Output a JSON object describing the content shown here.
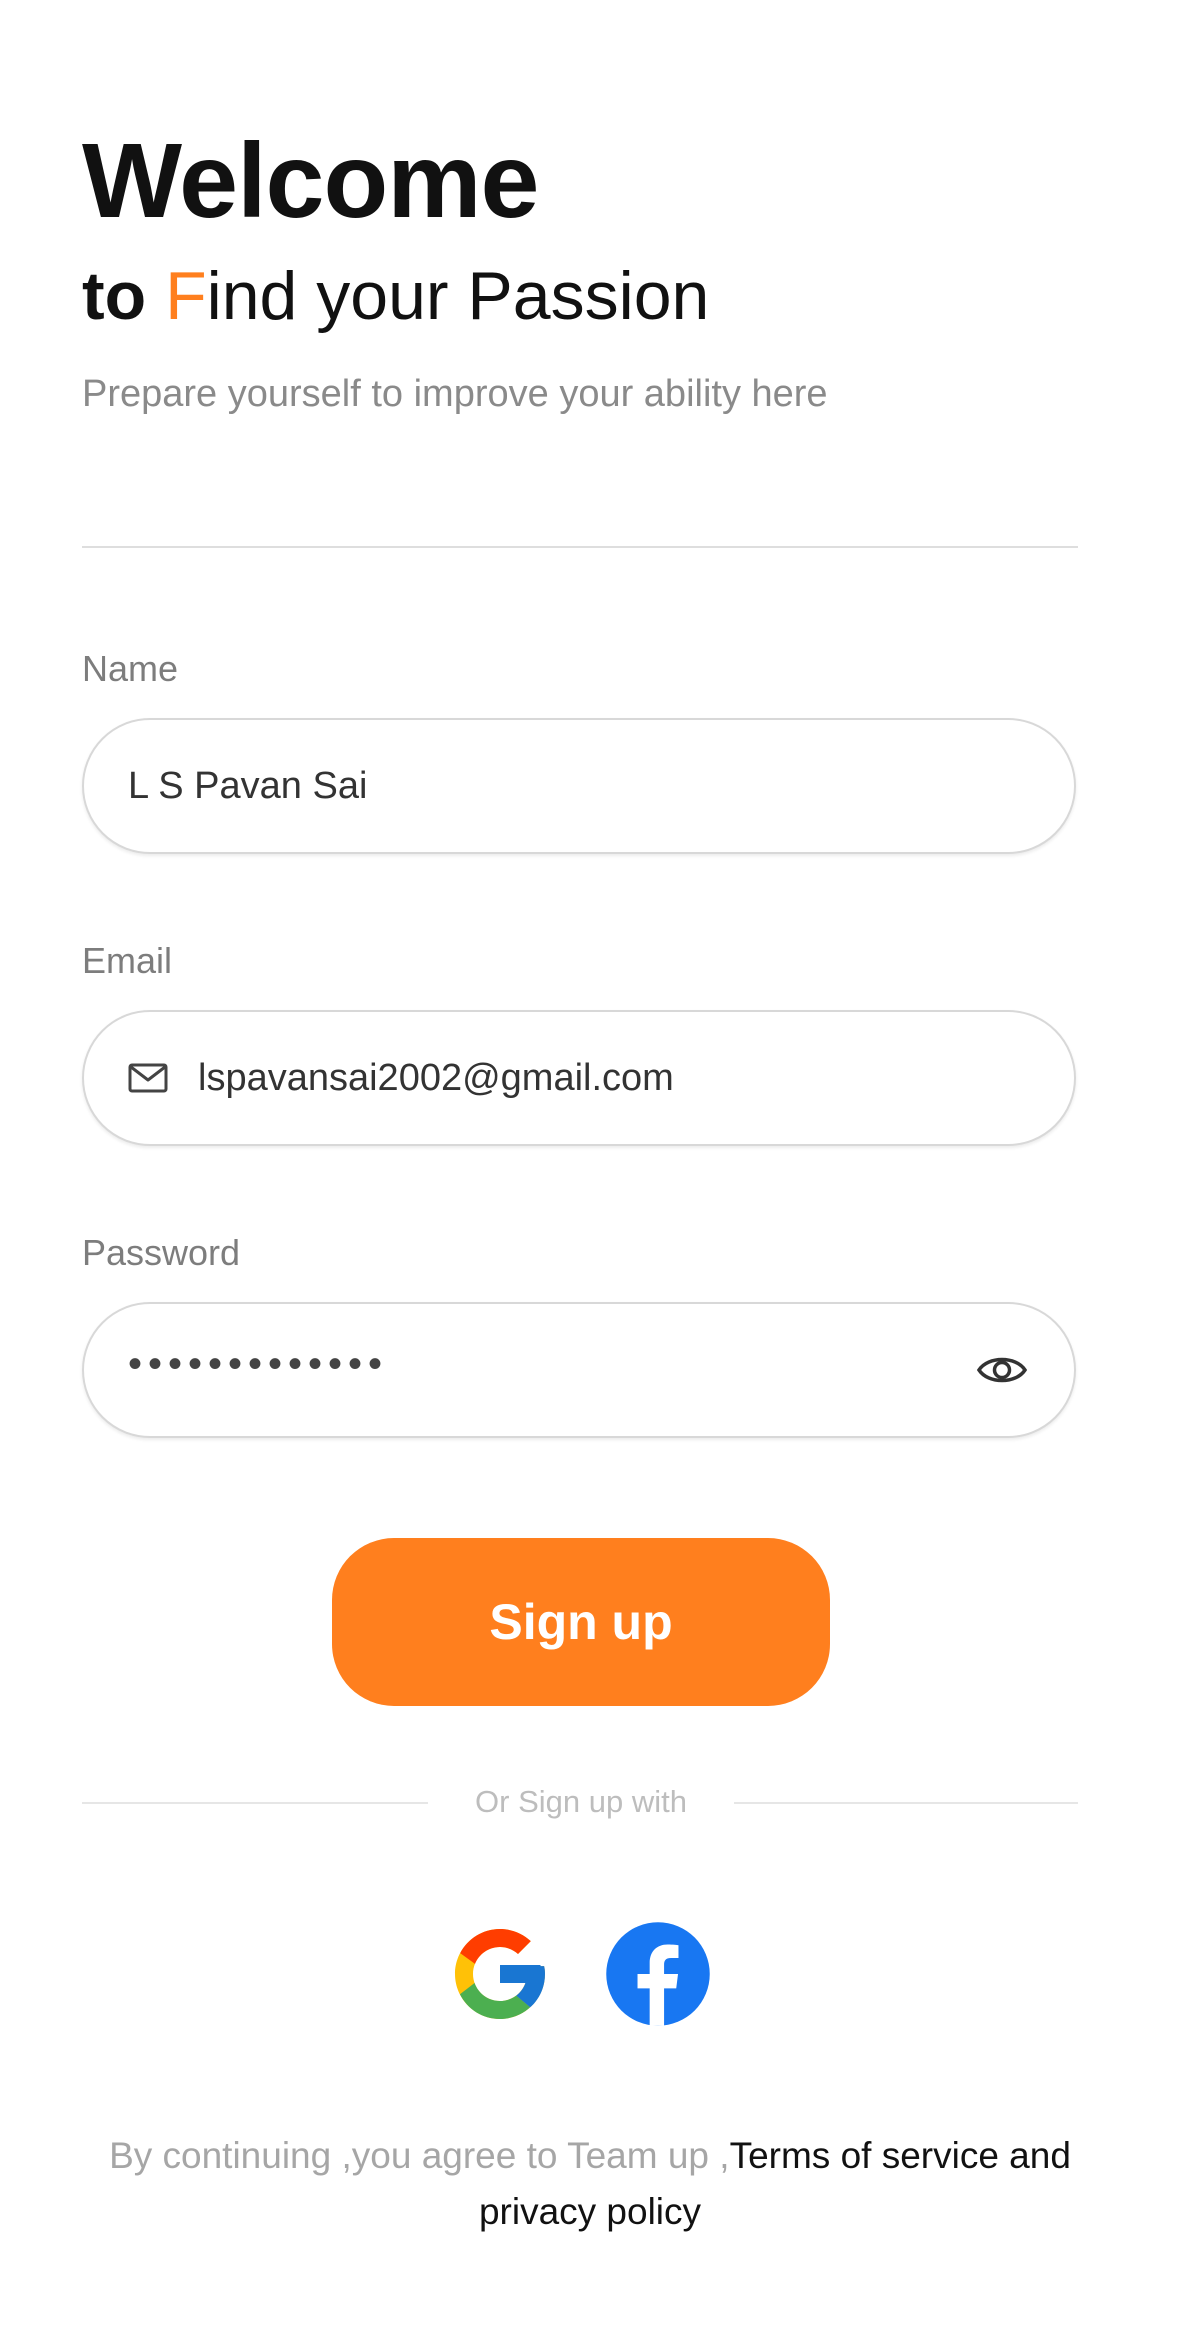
{
  "header": {
    "title": "Welcome",
    "subtitle_prefix": "to ",
    "subtitle_accent": "F",
    "subtitle_rest": "ind your Passion",
    "tagline": "Prepare yourself to improve your ability here",
    "accent_color": "#ff7f1e"
  },
  "form": {
    "name": {
      "label": "Name",
      "value": "L S Pavan Sai"
    },
    "email": {
      "label": "Email",
      "value": "lspavansai2002@gmail.com",
      "icon": "mail-icon"
    },
    "password": {
      "label": "Password",
      "value": "•••••••••••••",
      "icon": "eye-icon"
    },
    "submit_label": "Sign up"
  },
  "social": {
    "divider_text": "Or Sign up with",
    "providers": [
      "google-icon",
      "facebook-icon"
    ]
  },
  "footer": {
    "agreement_text": "By continuing ,you agree to Team up ,",
    "link_text": "Terms of service and privacy policy"
  }
}
